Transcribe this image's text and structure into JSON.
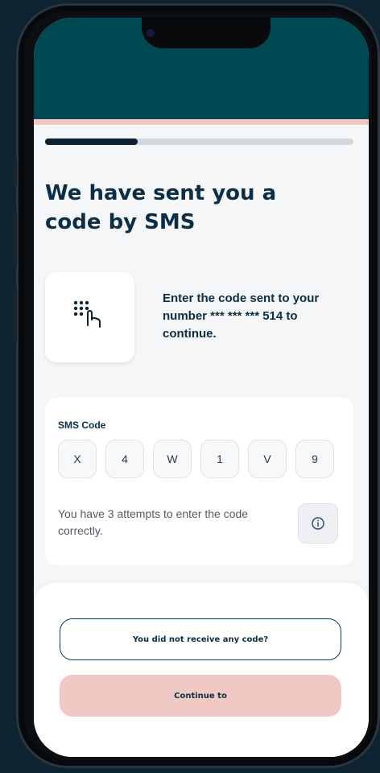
{
  "progress": {
    "fraction": 0.3
  },
  "title": "We have sent you a code by SMS",
  "intro": {
    "text": "Enter the code sent to your number *** *** *** 514 to continue.",
    "icon": "keypad-touch-icon"
  },
  "sms": {
    "label": "SMS Code",
    "digits": [
      "X",
      "4",
      "W",
      "1",
      "V",
      "9"
    ],
    "attempts_text": "You have 3 attempts to enter the code correctly.",
    "info_icon": "info-icon"
  },
  "actions": {
    "no_code": "You did not receive any code?",
    "continue": "Continue to"
  },
  "colors": {
    "header": "#004852",
    "accent": "#f3c7c1",
    "primary_text": "#0b2d45",
    "button_primary": "#f1c9c4"
  }
}
